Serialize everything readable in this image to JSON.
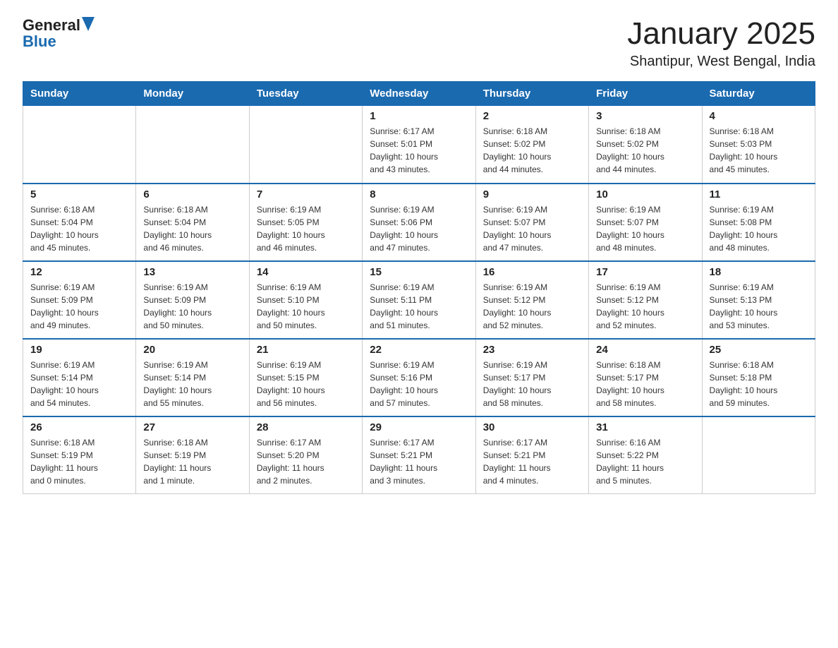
{
  "header": {
    "logo_general": "General",
    "logo_blue": "Blue",
    "main_title": "January 2025",
    "subtitle": "Shantipur, West Bengal, India"
  },
  "days_of_week": [
    "Sunday",
    "Monday",
    "Tuesday",
    "Wednesday",
    "Thursday",
    "Friday",
    "Saturday"
  ],
  "weeks": [
    [
      {
        "day": "",
        "info": ""
      },
      {
        "day": "",
        "info": ""
      },
      {
        "day": "",
        "info": ""
      },
      {
        "day": "1",
        "info": "Sunrise: 6:17 AM\nSunset: 5:01 PM\nDaylight: 10 hours\nand 43 minutes."
      },
      {
        "day": "2",
        "info": "Sunrise: 6:18 AM\nSunset: 5:02 PM\nDaylight: 10 hours\nand 44 minutes."
      },
      {
        "day": "3",
        "info": "Sunrise: 6:18 AM\nSunset: 5:02 PM\nDaylight: 10 hours\nand 44 minutes."
      },
      {
        "day": "4",
        "info": "Sunrise: 6:18 AM\nSunset: 5:03 PM\nDaylight: 10 hours\nand 45 minutes."
      }
    ],
    [
      {
        "day": "5",
        "info": "Sunrise: 6:18 AM\nSunset: 5:04 PM\nDaylight: 10 hours\nand 45 minutes."
      },
      {
        "day": "6",
        "info": "Sunrise: 6:18 AM\nSunset: 5:04 PM\nDaylight: 10 hours\nand 46 minutes."
      },
      {
        "day": "7",
        "info": "Sunrise: 6:19 AM\nSunset: 5:05 PM\nDaylight: 10 hours\nand 46 minutes."
      },
      {
        "day": "8",
        "info": "Sunrise: 6:19 AM\nSunset: 5:06 PM\nDaylight: 10 hours\nand 47 minutes."
      },
      {
        "day": "9",
        "info": "Sunrise: 6:19 AM\nSunset: 5:07 PM\nDaylight: 10 hours\nand 47 minutes."
      },
      {
        "day": "10",
        "info": "Sunrise: 6:19 AM\nSunset: 5:07 PM\nDaylight: 10 hours\nand 48 minutes."
      },
      {
        "day": "11",
        "info": "Sunrise: 6:19 AM\nSunset: 5:08 PM\nDaylight: 10 hours\nand 48 minutes."
      }
    ],
    [
      {
        "day": "12",
        "info": "Sunrise: 6:19 AM\nSunset: 5:09 PM\nDaylight: 10 hours\nand 49 minutes."
      },
      {
        "day": "13",
        "info": "Sunrise: 6:19 AM\nSunset: 5:09 PM\nDaylight: 10 hours\nand 50 minutes."
      },
      {
        "day": "14",
        "info": "Sunrise: 6:19 AM\nSunset: 5:10 PM\nDaylight: 10 hours\nand 50 minutes."
      },
      {
        "day": "15",
        "info": "Sunrise: 6:19 AM\nSunset: 5:11 PM\nDaylight: 10 hours\nand 51 minutes."
      },
      {
        "day": "16",
        "info": "Sunrise: 6:19 AM\nSunset: 5:12 PM\nDaylight: 10 hours\nand 52 minutes."
      },
      {
        "day": "17",
        "info": "Sunrise: 6:19 AM\nSunset: 5:12 PM\nDaylight: 10 hours\nand 52 minutes."
      },
      {
        "day": "18",
        "info": "Sunrise: 6:19 AM\nSunset: 5:13 PM\nDaylight: 10 hours\nand 53 minutes."
      }
    ],
    [
      {
        "day": "19",
        "info": "Sunrise: 6:19 AM\nSunset: 5:14 PM\nDaylight: 10 hours\nand 54 minutes."
      },
      {
        "day": "20",
        "info": "Sunrise: 6:19 AM\nSunset: 5:14 PM\nDaylight: 10 hours\nand 55 minutes."
      },
      {
        "day": "21",
        "info": "Sunrise: 6:19 AM\nSunset: 5:15 PM\nDaylight: 10 hours\nand 56 minutes."
      },
      {
        "day": "22",
        "info": "Sunrise: 6:19 AM\nSunset: 5:16 PM\nDaylight: 10 hours\nand 57 minutes."
      },
      {
        "day": "23",
        "info": "Sunrise: 6:19 AM\nSunset: 5:17 PM\nDaylight: 10 hours\nand 58 minutes."
      },
      {
        "day": "24",
        "info": "Sunrise: 6:18 AM\nSunset: 5:17 PM\nDaylight: 10 hours\nand 58 minutes."
      },
      {
        "day": "25",
        "info": "Sunrise: 6:18 AM\nSunset: 5:18 PM\nDaylight: 10 hours\nand 59 minutes."
      }
    ],
    [
      {
        "day": "26",
        "info": "Sunrise: 6:18 AM\nSunset: 5:19 PM\nDaylight: 11 hours\nand 0 minutes."
      },
      {
        "day": "27",
        "info": "Sunrise: 6:18 AM\nSunset: 5:19 PM\nDaylight: 11 hours\nand 1 minute."
      },
      {
        "day": "28",
        "info": "Sunrise: 6:17 AM\nSunset: 5:20 PM\nDaylight: 11 hours\nand 2 minutes."
      },
      {
        "day": "29",
        "info": "Sunrise: 6:17 AM\nSunset: 5:21 PM\nDaylight: 11 hours\nand 3 minutes."
      },
      {
        "day": "30",
        "info": "Sunrise: 6:17 AM\nSunset: 5:21 PM\nDaylight: 11 hours\nand 4 minutes."
      },
      {
        "day": "31",
        "info": "Sunrise: 6:16 AM\nSunset: 5:22 PM\nDaylight: 11 hours\nand 5 minutes."
      },
      {
        "day": "",
        "info": ""
      }
    ]
  ]
}
